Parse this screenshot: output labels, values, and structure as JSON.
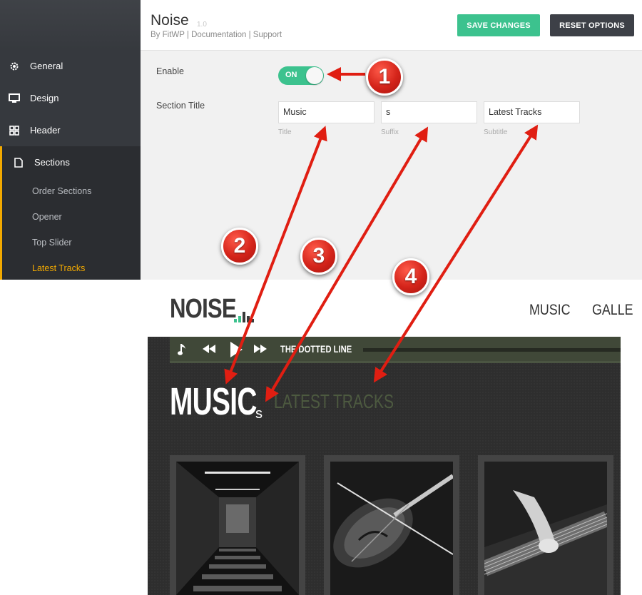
{
  "sidebar": {
    "items": [
      {
        "label": "General",
        "icon": "gear-icon"
      },
      {
        "label": "Design",
        "icon": "monitor-icon"
      },
      {
        "label": "Header",
        "icon": "grid-icon"
      },
      {
        "label": "Sections",
        "icon": "document-icon"
      }
    ],
    "sub_items": [
      {
        "label": "Order Sections"
      },
      {
        "label": "Opener"
      },
      {
        "label": "Top Slider"
      },
      {
        "label": "Latest Tracks"
      }
    ],
    "accent_color": "#f2a900"
  },
  "header": {
    "title": "Noise",
    "version": "1.0",
    "links": "By FitWP | Documentation | Support",
    "save_label": "SAVE CHANGES",
    "reset_label": "RESET OPTIONS"
  },
  "settings": {
    "enable_label": "Enable",
    "toggle_state": "ON",
    "section_title_label": "Section Title",
    "fields": [
      {
        "value": "Music",
        "caption": "Title"
      },
      {
        "value": "s",
        "caption": "Suffix"
      },
      {
        "value": "Latest Tracks",
        "caption": "Subtitle"
      }
    ]
  },
  "preview": {
    "logo": "NOISE",
    "nav": [
      "MUSIC",
      "GALLE"
    ],
    "track_name": "THE DOTTED LINE",
    "section_title": "MUSIC",
    "section_suffix": "s",
    "section_subtitle": "LATEST TRACKS"
  },
  "annotations": {
    "badges": [
      "1",
      "2",
      "3",
      "4"
    ],
    "color": "#e01e12"
  }
}
